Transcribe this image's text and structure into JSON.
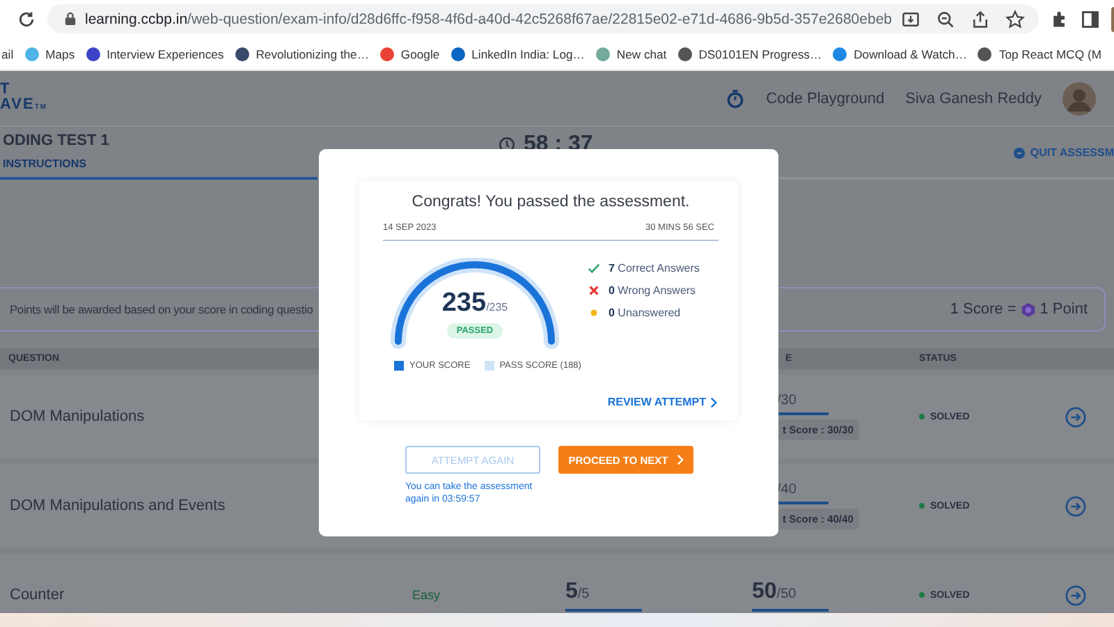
{
  "browser": {
    "url_host": "learning.ccbp.in",
    "url_path": "/web-question/exam-info/d28d6ffc-f958-4f6d-a40d-42c5268f67ae/22815e02-e71d-4686-9b5d-357e2680ebeb",
    "bookmarks": [
      {
        "label": "ail"
      },
      {
        "label": "Maps"
      },
      {
        "label": "Interview Experiences"
      },
      {
        "label": "Revolutionizing the…"
      },
      {
        "label": "Google"
      },
      {
        "label": "LinkedIn India: Log…"
      },
      {
        "label": "New chat"
      },
      {
        "label": "DS0101EN Progress…"
      },
      {
        "label": "Download & Watch…"
      },
      {
        "label": "Top React MCQ (M"
      }
    ]
  },
  "header": {
    "logo_top": "T",
    "logo_bottom": "AVE",
    "logo_mark": "TM",
    "link": "Code Playground",
    "user_name": "Siva Ganesh Reddy"
  },
  "test_bar": {
    "title": "ODING TEST 1",
    "tabs": [
      {
        "label": "INSTRUCTIONS",
        "selected": true
      }
    ],
    "timer": "58 : 37",
    "quit": "QUIT ASSESSM"
  },
  "info": {
    "text": "Points will be awarded based on your score in coding questio",
    "rule_left": "1 Score =",
    "rule_right": "1 Point"
  },
  "table": {
    "columns": [
      {
        "label": "QUESTION",
        "kind": "question"
      },
      {
        "label": "E",
        "kind": "points"
      },
      {
        "label": "STATUS",
        "kind": "status"
      }
    ],
    "rows": [
      {
        "question": "DOM Manipulations",
        "points": {
          "total": "/30",
          "level": 1,
          "best": "t Score : 30/30"
        },
        "status": "SOLVED"
      },
      {
        "question": "DOM Manipulations and Events",
        "points": {
          "total": "/40",
          "level": 1,
          "best": "t Score : 40/40"
        },
        "status": "SOLVED"
      },
      {
        "question": "Counter",
        "difficulty": "Easy",
        "score": {
          "value": "5",
          "total": "/5",
          "level": 1
        },
        "points": {
          "value": "50",
          "total": "/50",
          "level": 1
        },
        "status": "SOLVED"
      }
    ]
  },
  "dialog": {
    "title": "Congrats! You passed the assessment.",
    "date": "14 SEP 2023",
    "duration": "30 MINS 56 SEC",
    "gauge": {
      "score": "235",
      "total": "/235",
      "level": 1,
      "result": "PASSED"
    },
    "stats": [
      {
        "kind": "correct",
        "count": "7",
        "label": "Correct Answers"
      },
      {
        "kind": "wrong",
        "count": "0",
        "label": "Wrong Answers"
      },
      {
        "kind": "unanswered",
        "count": "0",
        "label": "Unanswered"
      }
    ],
    "legend": [
      {
        "label": "YOUR SCORE",
        "color": "#1a73d9"
      },
      {
        "label": "PASS SCORE (188)",
        "color": "#cfe3f8"
      }
    ],
    "review": "REVIEW ATTEMPT",
    "attempt_again": {
      "label": "ATTEMPT AGAIN",
      "disabled": true
    },
    "proceed": "PROCEED TO NEXT",
    "note": "You can take the assessment again in 03:59:57"
  }
}
